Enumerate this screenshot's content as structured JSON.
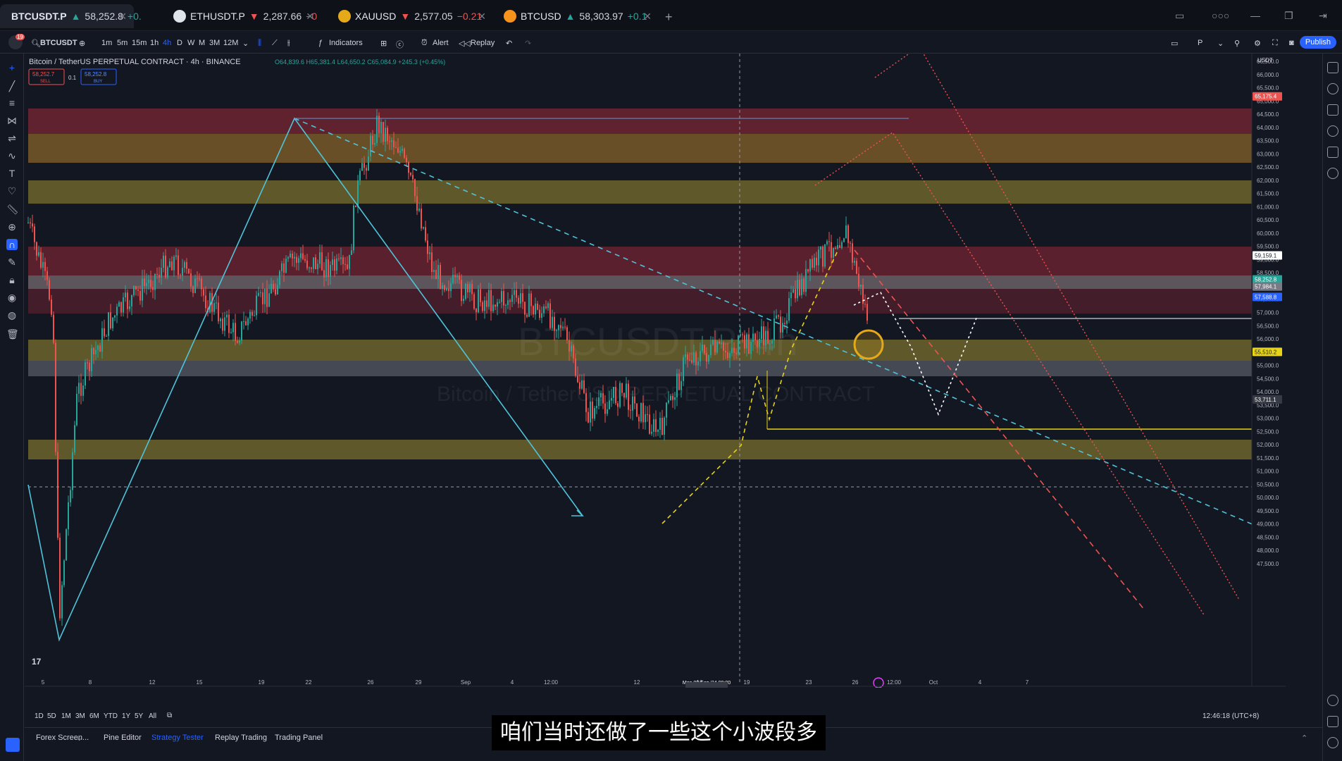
{
  "tabs": [
    {
      "symbol": "BTCUSDT.P",
      "price": "58,252.8",
      "change": "+0.",
      "dir": "up",
      "color": "#f7931a"
    },
    {
      "symbol": "ETHUSDT.P",
      "price": "2,287.66",
      "change": "−0",
      "dir": "dn",
      "color": "#dfe3ea"
    },
    {
      "symbol": "XAUUSD",
      "price": "2,577.05",
      "change": "−0.21",
      "dir": "dn",
      "color": "#e6a919"
    },
    {
      "symbol": "BTCUSD",
      "price": "58,303.97",
      "change": "+0.1",
      "dir": "up",
      "color": "#f7931a"
    }
  ],
  "toolbar": {
    "search_symbol": "BTCUSDT",
    "intervals": [
      "1m",
      "5m",
      "15m",
      "1h",
      "4h",
      "D",
      "W",
      "M",
      "3M",
      "12M"
    ],
    "active_interval": "4h",
    "indicators_label": "Indicators",
    "alert_label": "Alert",
    "replay_label": "Replay",
    "publish_label": "Publish",
    "notifications": "19",
    "account": "P"
  },
  "legend": {
    "title": "Bitcoin / TetherUS PERPETUAL CONTRACT · 4h · BINANCE",
    "ohlc": "O64,839.6 H65,381.4 L64,650.2 C65,084.9 +245.3 (+0.45%)",
    "sell_price": "58,252.7",
    "sell_label": "SELL",
    "spread": "0.1",
    "buy_price": "58,252.8",
    "buy_label": "BUY"
  },
  "watermark": {
    "line1": "BTCUSDT.P, 4h",
    "line2": "Bitcoin / TetherUSD PERPETUAL CONTRACT"
  },
  "currency": "USDT",
  "price_axis": [
    "66,500.0",
    "66,000.0",
    "65,500.0",
    "65,000.0",
    "64,500.0",
    "64,000.0",
    "63,500.0",
    "63,000.0",
    "62,500.0",
    "62,000.0",
    "61,500.0",
    "61,000.0",
    "60,500.0",
    "60,000.0",
    "59,500.0",
    "59,000.0",
    "58,500.0",
    "58,000.0",
    "57,500.0",
    "57,000.0",
    "56,500.0",
    "56,000.0",
    "55,500.0",
    "55,000.0",
    "54,500.0",
    "54,000.0",
    "53,500.0",
    "53,000.0",
    "52,500.0",
    "52,000.0",
    "51,500.0",
    "51,000.0",
    "50,500.0",
    "50,000.0",
    "49,500.0",
    "49,000.0",
    "48,500.0",
    "48,000.0",
    "47,500.0"
  ],
  "price_tags": [
    {
      "label": "65,175.4",
      "color": "#ef5350"
    },
    {
      "label": "59,159.1",
      "color": "#ffffff"
    },
    {
      "label": "58,252.8",
      "color": "#26a69a"
    },
    {
      "label": "57,984.1",
      "color": "#787b86"
    },
    {
      "label": "57,588.8",
      "color": "#2962ff"
    },
    {
      "label": "55,510.2",
      "color": "#e6d31a"
    },
    {
      "label": "53,711.1",
      "color": "#363a45"
    }
  ],
  "time_axis": [
    "5",
    "8",
    "12",
    "15",
    "19",
    "22",
    "26",
    "29",
    "Sep",
    "4",
    "12:00",
    "12",
    "16",
    "19",
    "23",
    "26",
    "12:00",
    "Oct",
    "4",
    "7"
  ],
  "crosshair_time": "Mon 09 Sep '24   08:00",
  "range_buttons": [
    "1D",
    "5D",
    "1M",
    "3M",
    "6M",
    "YTD",
    "1Y",
    "5Y",
    "All"
  ],
  "clock": "12:46:18 (UTC+8)",
  "bottom_tabs": [
    "Forex Screen...",
    "Pine Editor",
    "Strategy Tester",
    "Replay Trading",
    "Trading Panel"
  ],
  "active_bottom_tab": "Strategy Tester",
  "subtitle": "咱们当时还做了一些这个小波段多"
}
